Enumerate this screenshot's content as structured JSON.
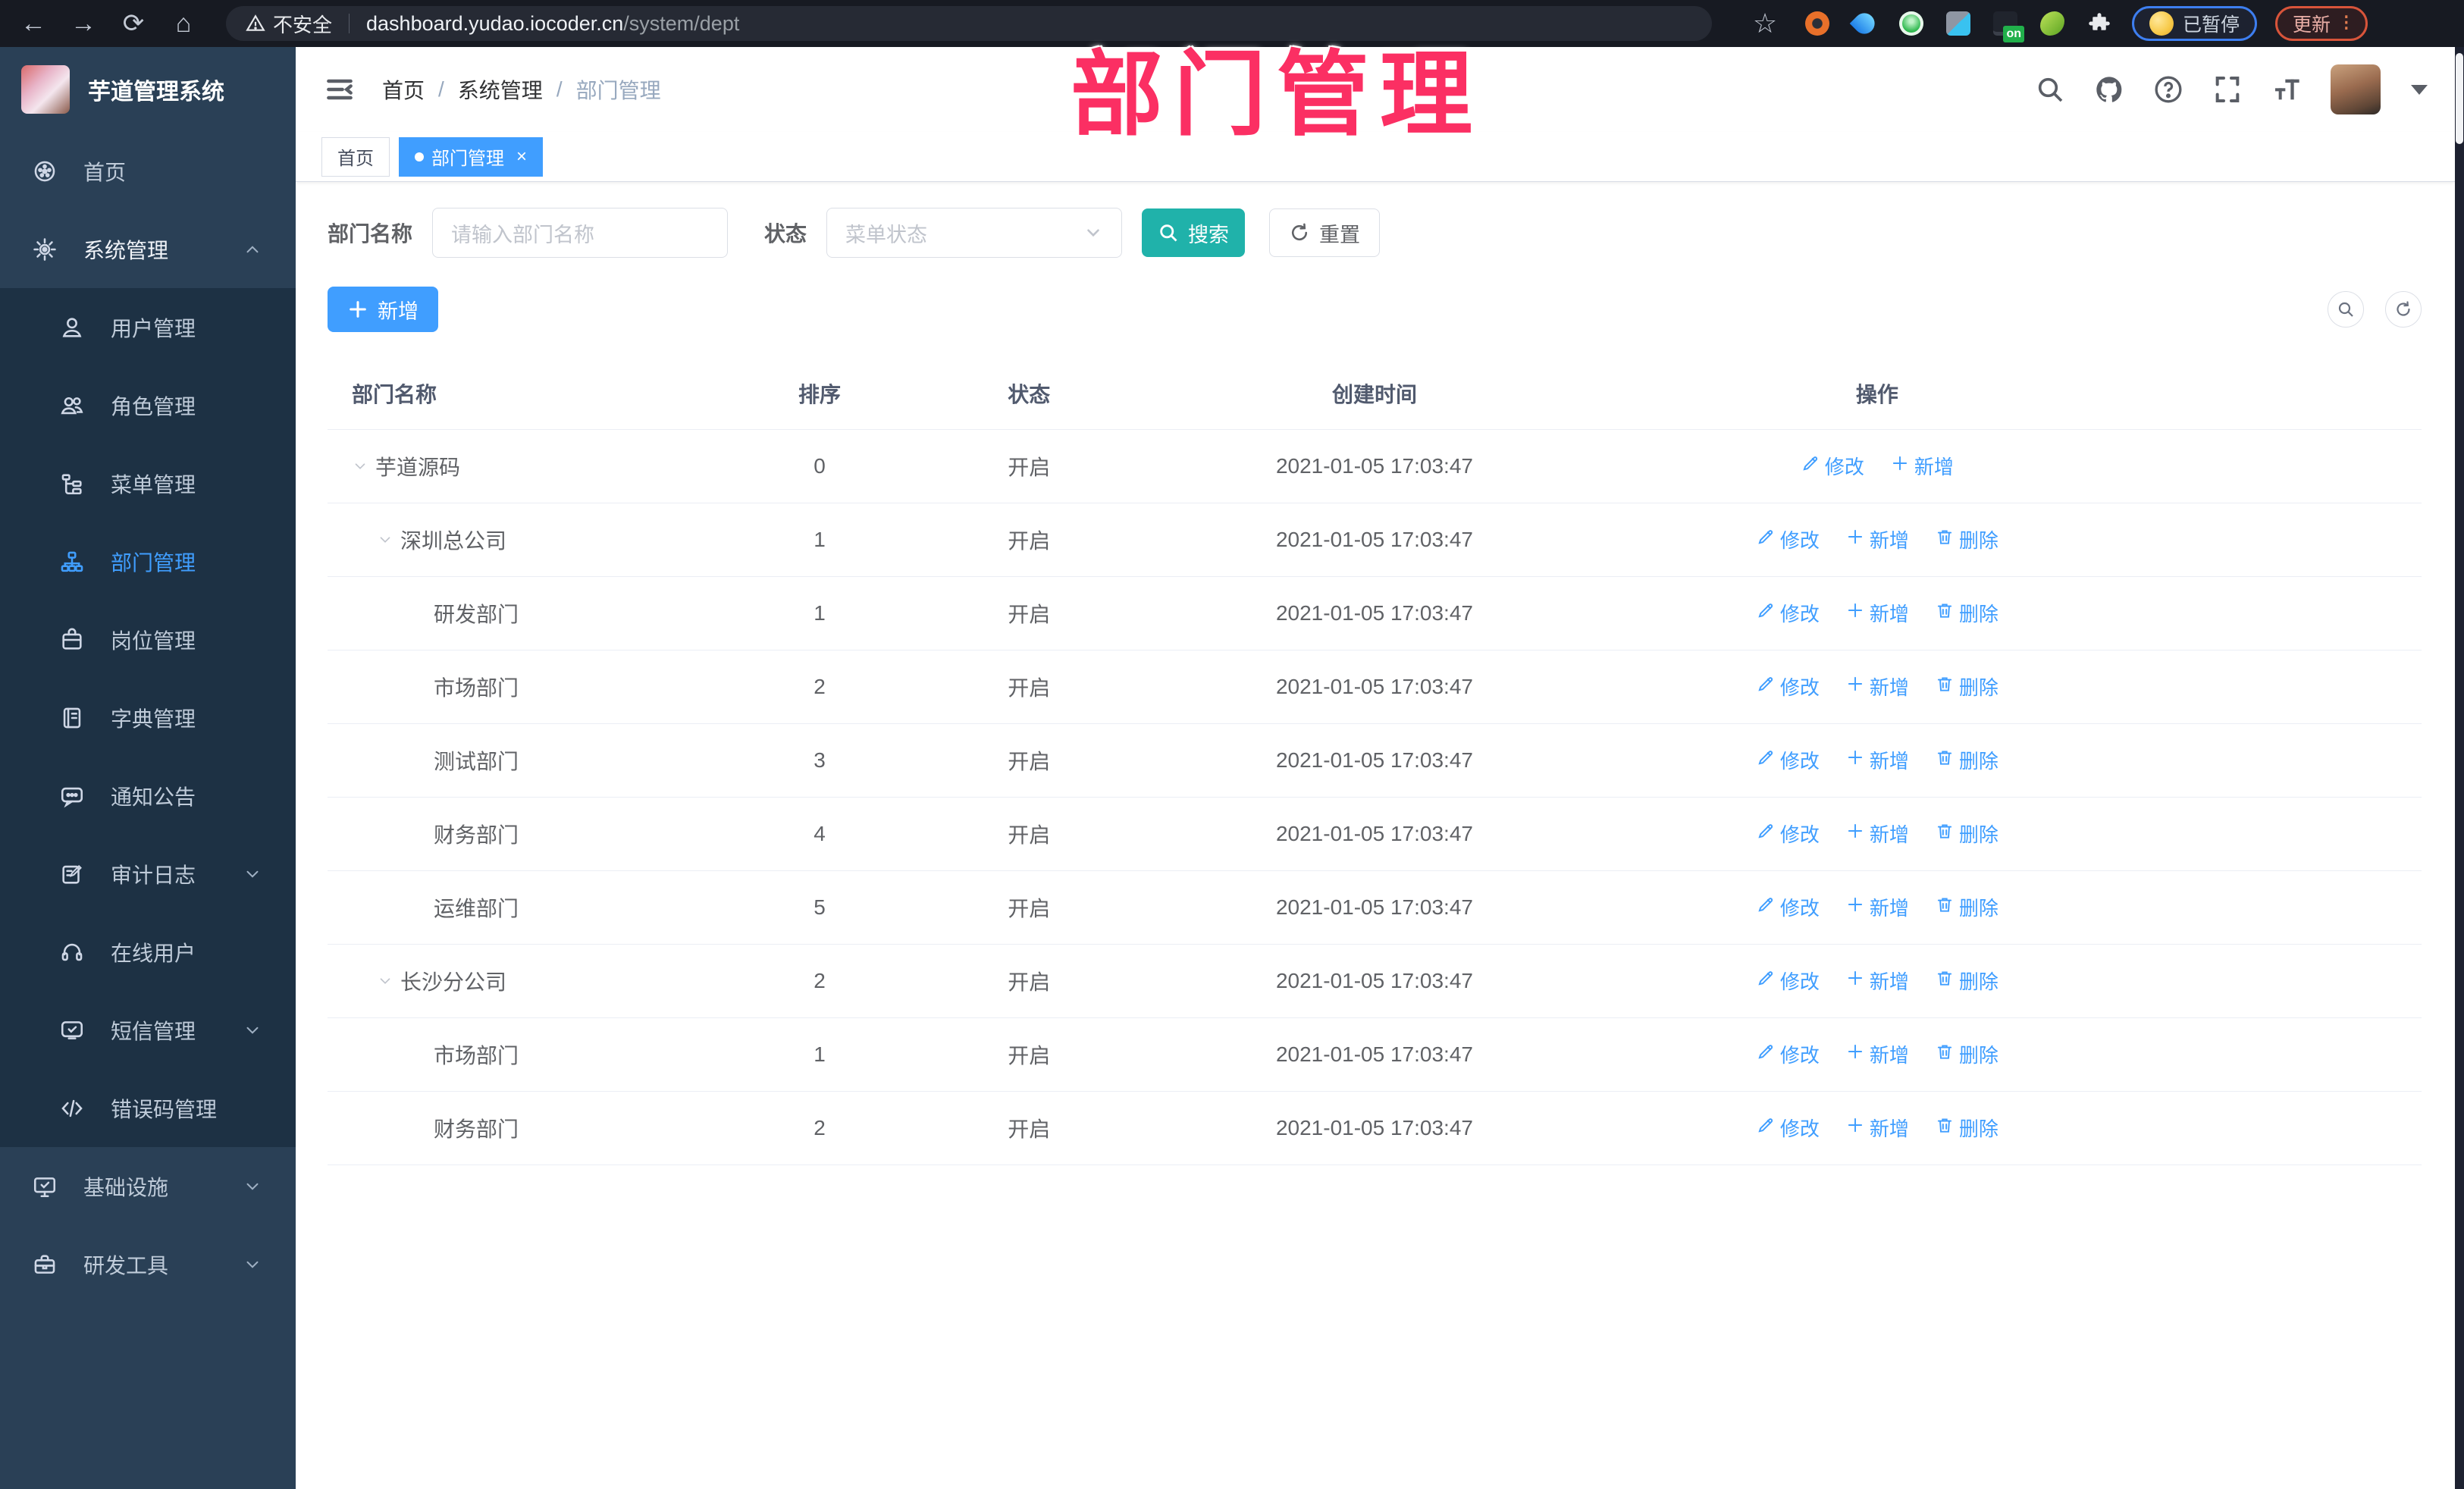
{
  "browser": {
    "security_label": "不安全",
    "url_host": "dashboard.yudao.iocoder.cn",
    "url_path": "/system/dept",
    "extension_badge": "on",
    "profile_status": "已暂停",
    "update_label": "更新"
  },
  "annotation": {
    "text": "部门管理",
    "color": "#fb2f63"
  },
  "sidebar": {
    "title": "芋道管理系统",
    "items": [
      {
        "label": "首页",
        "icon": "dashboard",
        "level": 0
      },
      {
        "label": "系统管理",
        "icon": "gear",
        "level": 0,
        "arrow": "up",
        "parent": true
      },
      {
        "label": "用户管理",
        "icon": "user",
        "level": 1
      },
      {
        "label": "角色管理",
        "icon": "users",
        "level": 1
      },
      {
        "label": "菜单管理",
        "icon": "tree",
        "level": 1
      },
      {
        "label": "部门管理",
        "icon": "org",
        "level": 1,
        "active": true
      },
      {
        "label": "岗位管理",
        "icon": "badge",
        "level": 1
      },
      {
        "label": "字典管理",
        "icon": "book",
        "level": 1
      },
      {
        "label": "通知公告",
        "icon": "announce",
        "level": 1
      },
      {
        "label": "审计日志",
        "icon": "log",
        "level": 1,
        "arrow": "down"
      },
      {
        "label": "在线用户",
        "icon": "headset",
        "level": 1
      },
      {
        "label": "短信管理",
        "icon": "sms",
        "level": 1,
        "arrow": "down"
      },
      {
        "label": "错误码管理",
        "icon": "code",
        "level": 1
      },
      {
        "label": "基础设施",
        "icon": "monitor",
        "level": 0,
        "arrow": "down"
      },
      {
        "label": "研发工具",
        "icon": "toolbox",
        "level": 0,
        "arrow": "down"
      }
    ]
  },
  "header": {
    "breadcrumb": [
      "首页",
      "系统管理",
      "部门管理"
    ]
  },
  "tabs": [
    {
      "label": "首页",
      "active": false
    },
    {
      "label": "部门管理",
      "active": true,
      "closable": true
    }
  ],
  "filters": {
    "name_label": "部门名称",
    "name_placeholder": "请输入部门名称",
    "status_label": "状态",
    "status_placeholder": "菜单状态",
    "search_label": "搜索",
    "reset_label": "重置"
  },
  "toolbar": {
    "add_label": "新增"
  },
  "table": {
    "columns": [
      "部门名称",
      "排序",
      "状态",
      "创建时间",
      "操作"
    ],
    "action_labels": {
      "edit": "修改",
      "add": "新增",
      "delete": "删除"
    },
    "rows": [
      {
        "name": "芋道源码",
        "level": 0,
        "caret": true,
        "sort": "0",
        "status": "开启",
        "time": "2021-01-05 17:03:47",
        "actions": [
          "edit",
          "add"
        ]
      },
      {
        "name": "深圳总公司",
        "level": 1,
        "caret": true,
        "sort": "1",
        "status": "开启",
        "time": "2021-01-05 17:03:47",
        "actions": [
          "edit",
          "add",
          "delete"
        ]
      },
      {
        "name": "研发部门",
        "level": 2,
        "caret": false,
        "sort": "1",
        "status": "开启",
        "time": "2021-01-05 17:03:47",
        "actions": [
          "edit",
          "add",
          "delete"
        ]
      },
      {
        "name": "市场部门",
        "level": 2,
        "caret": false,
        "sort": "2",
        "status": "开启",
        "time": "2021-01-05 17:03:47",
        "actions": [
          "edit",
          "add",
          "delete"
        ]
      },
      {
        "name": "测试部门",
        "level": 2,
        "caret": false,
        "sort": "3",
        "status": "开启",
        "time": "2021-01-05 17:03:47",
        "actions": [
          "edit",
          "add",
          "delete"
        ]
      },
      {
        "name": "财务部门",
        "level": 2,
        "caret": false,
        "sort": "4",
        "status": "开启",
        "time": "2021-01-05 17:03:47",
        "actions": [
          "edit",
          "add",
          "delete"
        ]
      },
      {
        "name": "运维部门",
        "level": 2,
        "caret": false,
        "sort": "5",
        "status": "开启",
        "time": "2021-01-05 17:03:47",
        "actions": [
          "edit",
          "add",
          "delete"
        ]
      },
      {
        "name": "长沙分公司",
        "level": 1,
        "caret": true,
        "sort": "2",
        "status": "开启",
        "time": "2021-01-05 17:03:47",
        "actions": [
          "edit",
          "add",
          "delete"
        ]
      },
      {
        "name": "市场部门",
        "level": 2,
        "caret": false,
        "sort": "1",
        "status": "开启",
        "time": "2021-01-05 17:03:47",
        "actions": [
          "edit",
          "add",
          "delete"
        ]
      },
      {
        "name": "财务部门",
        "level": 2,
        "caret": false,
        "sort": "2",
        "status": "开启",
        "time": "2021-01-05 17:03:47",
        "actions": [
          "edit",
          "add",
          "delete"
        ]
      }
    ]
  },
  "colors": {
    "primary": "#409EFF",
    "search_teal": "#20b2aa",
    "sidebar_bg": "#2a4056",
    "submenu_bg": "#1d3144",
    "annotation_pink": "#fb2f63"
  }
}
